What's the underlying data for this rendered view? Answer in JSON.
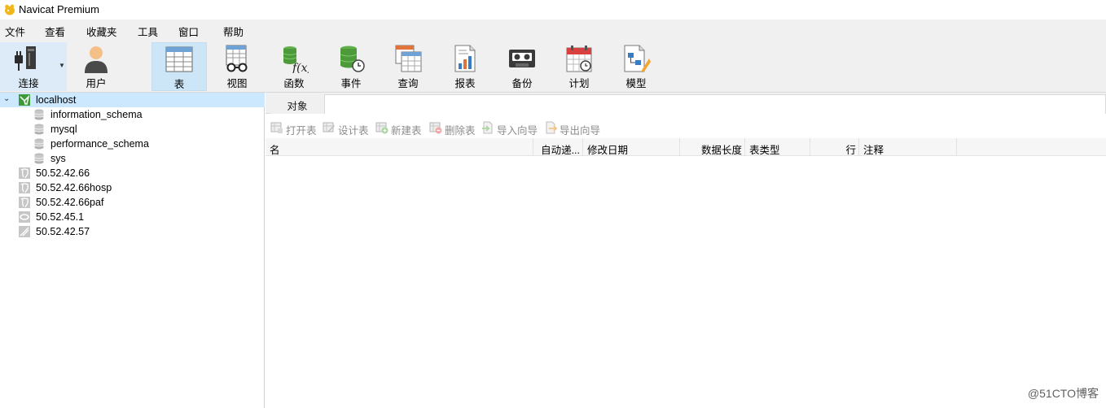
{
  "window": {
    "title": "Navicat Premium"
  },
  "menu": [
    "文件",
    "查看",
    "收藏夹",
    "工具",
    "窗口",
    "帮助"
  ],
  "toolbar": {
    "connection": "连接",
    "user": "用户",
    "items": [
      "表",
      "视图",
      "函数",
      "事件",
      "查询",
      "报表",
      "备份",
      "计划",
      "模型"
    ]
  },
  "tree": {
    "root": "localhost",
    "databases": [
      "information_schema",
      "mysql",
      "performance_schema",
      "sys"
    ],
    "connections": [
      "50.52.42.66",
      "50.52.42.66hosp",
      "50.52.42.66paf",
      "50.52.45.1",
      "50.52.42.57"
    ]
  },
  "tab": {
    "objects": "对象"
  },
  "object_toolbar": {
    "open": "打开表",
    "design": "设计表",
    "new": "新建表",
    "delete": "删除表",
    "import": "导入向导",
    "export": "导出向导"
  },
  "columns": {
    "name": "名",
    "auto_increment": "自动递...",
    "modified": "修改日期",
    "data_length": "数据长度",
    "table_type": "表类型",
    "rows": "行",
    "comment": "注释"
  },
  "watermark": "@51CTO博客",
  "colors": {
    "selected_row": "#cce8ff",
    "active_tool": "#cde6f7",
    "toolbar_bg": "#f0f0f0"
  }
}
